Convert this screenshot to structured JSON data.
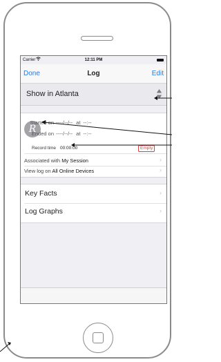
{
  "status_bar": {
    "carrier": "Carrier",
    "wifi_icon": "wifi-icon",
    "time": "12:11 PM",
    "battery_icon": "battery-icon"
  },
  "nav": {
    "left_label": "Done",
    "title": "Log",
    "right_label": "Edit"
  },
  "location_picker": {
    "value": "Show in Atlanta",
    "icon": "up-down-arrows-icon"
  },
  "session": {
    "avatar_letter": "R",
    "started_label": "Started on",
    "started_date": "----/--/--",
    "started_at": "at",
    "started_time": "--:--",
    "ended_label": "Ended on",
    "ended_date": "----/--/--",
    "ended_at": "at",
    "ended_time": "--:--",
    "record_time_label": "Record time",
    "record_time_value": "00:00:00",
    "status_badge": "Empty"
  },
  "associated": {
    "prefix": "Associated with",
    "value": "My Session"
  },
  "view_log": {
    "prefix": "View log on",
    "value": "All Online Devices"
  },
  "groups": [
    {
      "label": "Key Facts"
    },
    {
      "label": "Log Graphs"
    }
  ],
  "colors": {
    "accent": "#1a7cf5",
    "badge": "#e23b3b",
    "background": "#efeff4"
  }
}
